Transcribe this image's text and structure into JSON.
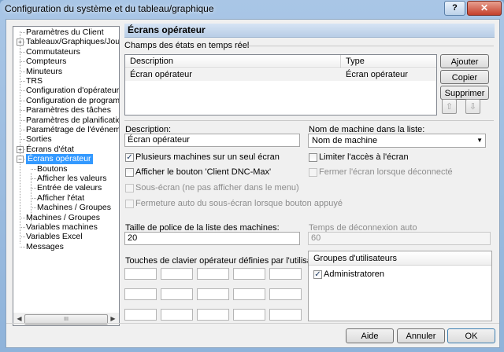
{
  "window": {
    "title": "Configuration du système et du tableau/graphique",
    "help_label": "?",
    "close_label": "✕"
  },
  "tree": {
    "items": [
      {
        "label": "Paramètres du Client"
      },
      {
        "label": "Tableaux/Graphiques/Journal",
        "expander": "+"
      },
      {
        "label": "Commutateurs"
      },
      {
        "label": "Compteurs"
      },
      {
        "label": "Minuteurs"
      },
      {
        "label": "TRS"
      },
      {
        "label": "Configuration d'opérateur"
      },
      {
        "label": "Configuration de programme"
      },
      {
        "label": "Paramètres des tâches"
      },
      {
        "label": "Paramètres de planification"
      },
      {
        "label": "Paramétrage de l'événement"
      },
      {
        "label": "Sorties"
      },
      {
        "label": "Écrans d'état",
        "expander": "+"
      },
      {
        "label": "Écrans opérateur",
        "expander": "−",
        "selected": true
      },
      {
        "label": "Boutons"
      },
      {
        "label": "Afficher les valeurs"
      },
      {
        "label": "Entrée de valeurs"
      },
      {
        "label": "Afficher l'état"
      },
      {
        "label": "Machines / Groupes"
      },
      {
        "label": "Machines / Groupes"
      },
      {
        "label": "Variables machines"
      },
      {
        "label": "Variables Excel"
      },
      {
        "label": "Messages"
      }
    ],
    "scroll_thumb_label": "III"
  },
  "panel": {
    "title": "Écrans opérateur",
    "realtime_group": "Champs des états en temps réel",
    "list": {
      "col_description": "Description",
      "col_type": "Type",
      "rows": [
        {
          "description": "Écran opérateur",
          "type": "Écran opérateur"
        }
      ]
    },
    "buttons": {
      "add": "Ajouter",
      "copy": "Copier",
      "delete": "Supprimer",
      "up": "⇧",
      "down": "⇩"
    },
    "description_label": "Description:",
    "description_value": "Écran opérateur",
    "machine_name_label": "Nom de machine dans la liste:",
    "machine_name_value": "Nom de machine",
    "checks": {
      "multi_machines": {
        "label": "Plusieurs machines sur un seul écran",
        "checked": true
      },
      "show_dnc_max": {
        "label": "Afficher le bouton 'Client DNC-Max'",
        "checked": false
      },
      "sub_screen": {
        "label": "Sous-écran (ne pas afficher dans le menu)",
        "checked": false
      },
      "auto_close": {
        "label": "Fermeture auto du sous-écran lorsque bouton appuyé",
        "checked": false
      },
      "limit_access": {
        "label": "Limiter l'accès à l'écran",
        "checked": false
      },
      "close_on_logout": {
        "label": "Fermer l'écran lorsque déconnecté",
        "checked": false
      }
    },
    "font_size_label": "Taille de police de la liste des machines:",
    "font_size_value": "20",
    "timeout_label": "Temps de déconnexion auto",
    "timeout_value": "60",
    "keys_label": "Touches de clavier opérateur définies par l'utilisateur:",
    "groups": {
      "header": "Groupes d'utilisateurs",
      "items": [
        {
          "label": "Administratoren",
          "checked": true
        }
      ]
    }
  },
  "footer": {
    "help": "Aide",
    "cancel": "Annuler",
    "ok": "OK"
  },
  "colors": {
    "selection": "#3399ff",
    "header_gradient_top": "#d6e4f4",
    "header_gradient_bottom": "#b8cde6"
  }
}
